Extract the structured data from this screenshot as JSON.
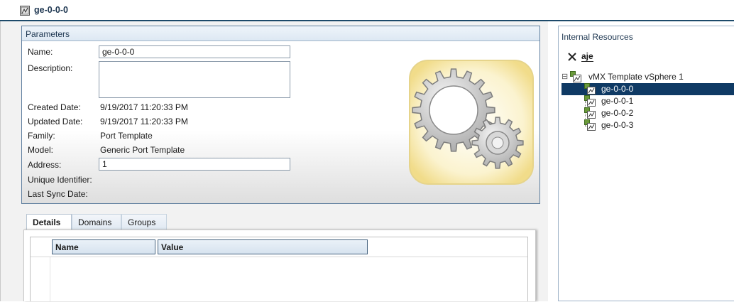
{
  "window": {
    "title": "ge-0-0-0"
  },
  "parameters": {
    "header": "Parameters",
    "name_label": "Name:",
    "name_value": "ge-0-0-0",
    "description_label": "Description:",
    "description_value": "",
    "created_label": "Created Date:",
    "created_value": "9/19/2017 11:20:33 PM",
    "updated_label": "Updated Date:",
    "updated_value": "9/19/2017 11:20:33 PM",
    "family_label": "Family:",
    "family_value": "Port Template",
    "model_label": "Model:",
    "model_value": "Generic Port Template",
    "address_label": "Address:",
    "address_value": "1",
    "uid_label": "Unique Identifier:",
    "uid_value": "",
    "sync_label": "Last Sync Date:",
    "sync_value": "",
    "illustration_icon": "gears-icon"
  },
  "tabs": [
    {
      "label": "Details",
      "active": true
    },
    {
      "label": "Domains",
      "active": false
    },
    {
      "label": "Groups",
      "active": false
    }
  ],
  "details_grid": {
    "columns": [
      "Name",
      "Value"
    ],
    "rows": []
  },
  "internal_resources": {
    "header": "Internal Resources",
    "toolbar": {
      "delete_icon": "close-icon",
      "rename_icon": "rename-icon",
      "rename_glyph": "aje"
    },
    "tree": {
      "root": {
        "label": "vMX Template vSphere 1",
        "expanded": true,
        "toggle_glyph": "⊟"
      },
      "children": [
        {
          "label": "ge-0-0-0",
          "selected": true
        },
        {
          "label": "ge-0-0-1",
          "selected": false
        },
        {
          "label": "ge-0-0-2",
          "selected": false
        },
        {
          "label": "ge-0-0-3",
          "selected": false
        }
      ]
    }
  },
  "colors": {
    "accent": "#1d4a6a",
    "selection": "#0f3a64",
    "group_border": "#5f7f9f"
  }
}
